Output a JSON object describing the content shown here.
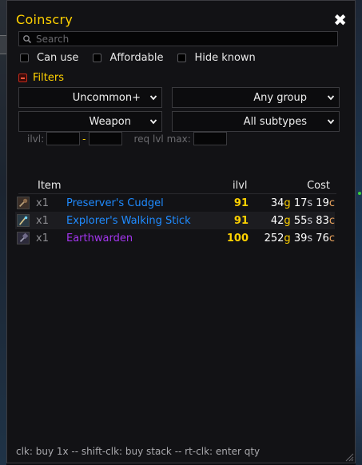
{
  "window": {
    "title": "Coinscry",
    "close_glyph": "✖"
  },
  "search": {
    "placeholder": "Search",
    "value": ""
  },
  "checkboxes": [
    {
      "label": "Can use",
      "checked": false
    },
    {
      "label": "Affordable",
      "checked": false
    },
    {
      "label": "Hide known",
      "checked": false
    }
  ],
  "filters": {
    "label": "Filters",
    "quality": "Uncommon+",
    "group": "Any group",
    "type": "Weapon",
    "subtype": "All subtypes",
    "ilvl_label": "ilvl:",
    "range_dash": "-",
    "req_label": "req lvl max:"
  },
  "table": {
    "headers": {
      "item": "Item",
      "ilvl": "ilvl",
      "cost": "Cost"
    },
    "rows": [
      {
        "qty": "x1",
        "name": "Preserver's Cudgel",
        "name_color": "#1f8bff",
        "ilvl": "91",
        "gold": "34",
        "silver": "17",
        "copper": "19",
        "icon": "mace-icon"
      },
      {
        "qty": "x1",
        "name": "Explorer's Walking Stick",
        "name_color": "#1f8bff",
        "ilvl": "91",
        "gold": "42",
        "silver": "55",
        "copper": "83",
        "icon": "staff-icon"
      },
      {
        "qty": "x1",
        "name": "Earthwarden",
        "name_color": "#a335ee",
        "ilvl": "100",
        "gold": "252",
        "silver": "39",
        "copper": "76",
        "icon": "hammer-icon"
      }
    ],
    "units": {
      "gold": "g",
      "silver": "s",
      "copper": "c"
    }
  },
  "footer": {
    "hint": "clk: buy 1x -- shift-clk: buy stack -- rt-clk: enter qty"
  },
  "colors": {
    "accent": "#ffd100",
    "rare": "#1f8bff",
    "epic": "#a335ee"
  }
}
